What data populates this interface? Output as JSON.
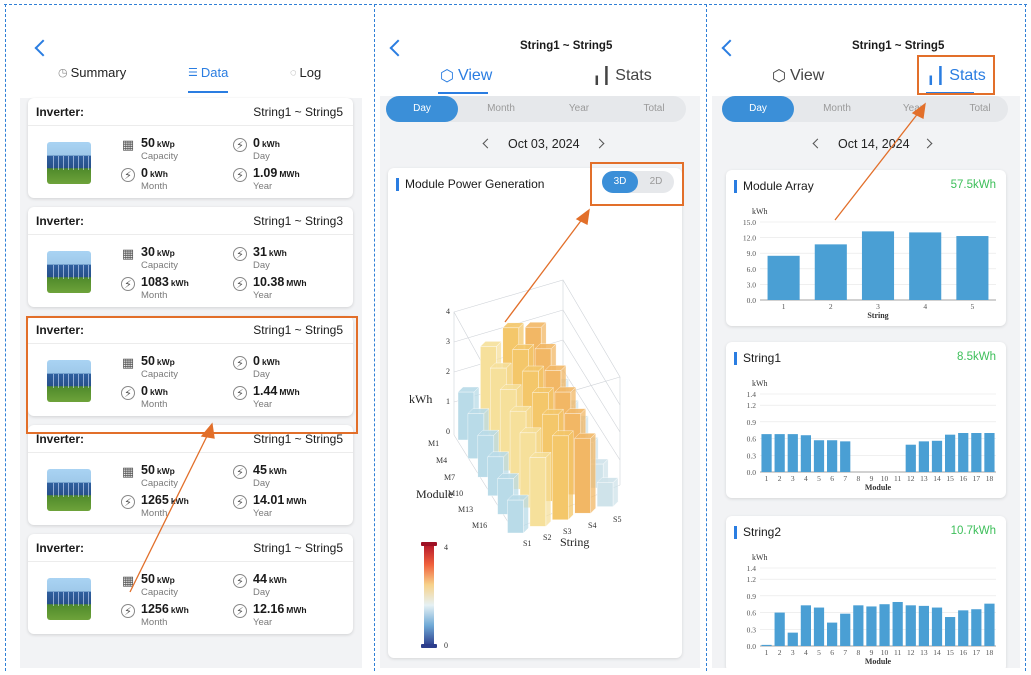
{
  "panel1": {
    "tabs": [
      {
        "label": "Summary",
        "icon": "clock-icon"
      },
      {
        "label": "Data",
        "icon": "list-icon"
      },
      {
        "label": "Log",
        "icon": "chat-icon"
      }
    ],
    "active_tab": "Data",
    "cards": [
      {
        "label": "Inverter:",
        "strings": "String1 ~ String5",
        "capacity": "50",
        "capacity_unit": "kWp",
        "capacity_label": "Capacity",
        "day": "0",
        "day_unit": "kWh",
        "day_label": "Day",
        "month": "0",
        "month_unit": "kWh",
        "month_label": "Month",
        "year": "1.09",
        "year_unit": "MWh",
        "year_label": "Year"
      },
      {
        "label": "Inverter:",
        "strings": "String1 ~ String3",
        "capacity": "30",
        "capacity_unit": "kWp",
        "capacity_label": "Capacity",
        "day": "31",
        "day_unit": "kWh",
        "day_label": "Day",
        "month": "1083",
        "month_unit": "kWh",
        "month_label": "Month",
        "year": "10.38",
        "year_unit": "MWh",
        "year_label": "Year"
      },
      {
        "label": "Inverter:",
        "strings": "String1 ~ String5",
        "capacity": "50",
        "capacity_unit": "kWp",
        "capacity_label": "Capacity",
        "day": "0",
        "day_unit": "kWh",
        "day_label": "Day",
        "month": "0",
        "month_unit": "kWh",
        "month_label": "Month",
        "year": "1.44",
        "year_unit": "MWh",
        "year_label": "Year"
      },
      {
        "label": "Inverter:",
        "strings": "String1 ~ String5",
        "capacity": "50",
        "capacity_unit": "kWp",
        "capacity_label": "Capacity",
        "day": "45",
        "day_unit": "kWh",
        "day_label": "Day",
        "month": "1265",
        "month_unit": "kWh",
        "month_label": "Month",
        "year": "14.01",
        "year_unit": "MWh",
        "year_label": "Year"
      },
      {
        "label": "Inverter:",
        "strings": "String1 ~ String5",
        "capacity": "50",
        "capacity_unit": "kWp",
        "capacity_label": "Capacity",
        "day": "44",
        "day_unit": "kWh",
        "day_label": "Day",
        "month": "1256",
        "month_unit": "kWh",
        "month_label": "Month",
        "year": "12.16",
        "year_unit": "MWh",
        "year_label": "Year"
      }
    ]
  },
  "panel2": {
    "title": "String1 ~ String5",
    "tabs": [
      {
        "label": "View",
        "icon": "cube-icon"
      },
      {
        "label": "Stats",
        "icon": "bar-chart-icon"
      }
    ],
    "active_tab": "View",
    "periods": [
      "Day",
      "Month",
      "Year",
      "Total"
    ],
    "active_period": "Day",
    "date": "Oct 03, 2024",
    "card_title": "Module Power Generation",
    "toggle": [
      "3D",
      "2D"
    ],
    "active_toggle": "3D",
    "chart": {
      "z_label": "kWh",
      "z_ticks": [
        "0",
        "1",
        "2",
        "3",
        "4"
      ],
      "y_label": "Module",
      "y_ticks": [
        "M1",
        "M4",
        "M7",
        "M10",
        "M13",
        "M16"
      ],
      "x_label": "String",
      "x_ticks": [
        "S1",
        "S2",
        "S3",
        "S4",
        "S5"
      ],
      "scale_max": "4",
      "scale_min": "0"
    }
  },
  "panel3": {
    "title": "String1 ~ String5",
    "tabs": [
      {
        "label": "View",
        "icon": "cube-icon"
      },
      {
        "label": "Stats",
        "icon": "bar-chart-icon"
      }
    ],
    "active_tab": "Stats",
    "periods": [
      "Day",
      "Month",
      "Year",
      "Total"
    ],
    "active_period": "Day",
    "date": "Oct 14, 2024",
    "cards": [
      {
        "title": "Module Array",
        "total": "57.5kWh"
      },
      {
        "title": "String1",
        "total": "8.5kWh"
      },
      {
        "title": "String2",
        "total": "10.7kWh"
      }
    ]
  },
  "chart_data": [
    {
      "type": "bar",
      "title": "Module Array",
      "ylabel": "kWh",
      "xlabel": "String",
      "categories": [
        "1",
        "2",
        "3",
        "4",
        "5"
      ],
      "values": [
        8.5,
        10.7,
        13.2,
        13.0,
        12.3
      ],
      "yticks": [
        "0.0",
        "3.0",
        "6.0",
        "9.0",
        "12.0",
        "15.0"
      ],
      "ylim": [
        0,
        15
      ],
      "color": "#4a9fd4"
    },
    {
      "type": "bar",
      "title": "String1",
      "ylabel": "kWh",
      "xlabel": "Module",
      "categories": [
        "1",
        "2",
        "3",
        "4",
        "5",
        "6",
        "7",
        "8",
        "9",
        "10",
        "11",
        "12",
        "13",
        "14",
        "15",
        "16",
        "17",
        "18"
      ],
      "values": [
        0.68,
        0.68,
        0.68,
        0.66,
        0.57,
        0.57,
        0.55,
        0,
        0,
        0,
        0,
        0.49,
        0.55,
        0.56,
        0.67,
        0.7,
        0.7,
        0.7
      ],
      "yticks": [
        "0.0",
        "0.3",
        "0.6",
        "0.9",
        "1.2",
        "1.4"
      ],
      "ylim": [
        0,
        1.4
      ],
      "color": "#4a9fd4"
    },
    {
      "type": "bar",
      "title": "String2",
      "ylabel": "kWh",
      "xlabel": "Module",
      "categories": [
        "1",
        "2",
        "3",
        "4",
        "5",
        "6",
        "7",
        "8",
        "9",
        "10",
        "11",
        "12",
        "13",
        "14",
        "15",
        "16",
        "17",
        "18"
      ],
      "values": [
        0.02,
        0.6,
        0.24,
        0.73,
        0.69,
        0.42,
        0.58,
        0.73,
        0.71,
        0.75,
        0.79,
        0.73,
        0.72,
        0.69,
        0.52,
        0.64,
        0.66,
        0.76
      ],
      "yticks": [
        "0.0",
        "0.3",
        "0.6",
        "0.9",
        "1.2",
        "1.4"
      ],
      "ylim": [
        0,
        1.4
      ],
      "color": "#4a9fd4"
    }
  ],
  "colors": {
    "accent": "#2a7de1",
    "highlight": "#e26f2a",
    "green": "#3dbf5a",
    "bar": "#4a9fd4"
  }
}
